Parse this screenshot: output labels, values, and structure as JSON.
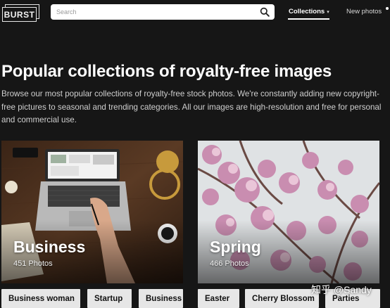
{
  "header": {
    "logo_text": "BURST",
    "search": {
      "placeholder": "Search",
      "value": ""
    },
    "nav": {
      "collections": "Collections",
      "collections_caret": "▾",
      "new_photos": "New photos"
    }
  },
  "main": {
    "title": "Popular collections of royalty-free images",
    "description": "Browse our most popular collections of royalty-free stock photos. We're constantly adding new copyright-free pictures to seasonal and trending categories. All our images are high-resolution and free for personal and commercial use."
  },
  "collections": [
    {
      "name": "Business",
      "count": "451 Photos",
      "tags": [
        "Business woman",
        "Startup",
        "Business"
      ]
    },
    {
      "name": "Spring",
      "count": "466 Photos",
      "tags": [
        "Easter",
        "Cherry Blossom",
        "Parties"
      ]
    }
  ],
  "watermark": "知乎 @Sandy",
  "colors": {
    "background": "#161616",
    "tag_bg": "#e6e6e6",
    "text": "#ffffff"
  },
  "icons": {
    "search": "search-icon",
    "caret": "chevron-down-icon"
  }
}
